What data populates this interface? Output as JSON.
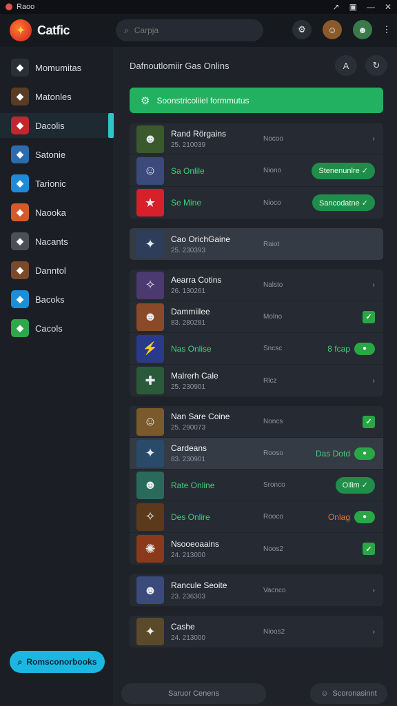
{
  "titlebar": {
    "title": "Raoo",
    "controls": [
      "↗",
      "▣",
      "—",
      "✕"
    ]
  },
  "header": {
    "app_name": "Catfic",
    "search_placeholder": "Carpja",
    "icons": [
      "notifications-icon",
      "trophy-icon",
      "avatar"
    ]
  },
  "sidebar": {
    "items": [
      {
        "label": "Momumitas",
        "icon": "avatar-icon",
        "color": "#2b2f36"
      },
      {
        "label": "Matonles",
        "icon": "game-icon",
        "color": "#5a3b24"
      },
      {
        "label": "Dacolis",
        "icon": "game-icon",
        "color": "#c2262e",
        "active": true
      },
      {
        "label": "Satonie",
        "icon": "game-icon",
        "color": "#2b6cb0"
      },
      {
        "label": "Tarionic",
        "icon": "game-icon",
        "color": "#1f8ad8"
      },
      {
        "label": "Naooka",
        "icon": "game-icon",
        "color": "#d35b2b"
      },
      {
        "label": "Nacants",
        "icon": "game-icon",
        "color": "#4a4f58"
      },
      {
        "label": "Danntol",
        "icon": "game-icon",
        "color": "#7a4a2a"
      },
      {
        "label": "Bacoks",
        "icon": "game-icon",
        "color": "#1c8fd6"
      },
      {
        "label": "Cacols",
        "icon": "game-icon",
        "color": "#2ea84a"
      }
    ],
    "bottom_button": "Romsconorbooks"
  },
  "main": {
    "title": "Dafnoutlomiir Gas Onlins",
    "banner": "Soonstricoliiel formmutus",
    "footer_left": "Saruor Cenens",
    "footer_right": "Scoronasinnt"
  },
  "groups": [
    {
      "rows": [
        {
          "name": "Rand Rörgains",
          "sub": "25. 210039",
          "mid": "Nocoo",
          "right": {
            "type": "chevron"
          },
          "thumb": "#3a5a2e",
          "glyph": "☻"
        },
        {
          "name": "Sa Onlile",
          "green": true,
          "mid": "Niono",
          "right": {
            "type": "pill",
            "text": "Stenenunlre ✓"
          },
          "thumb": "#3b4a7a",
          "glyph": "☺"
        },
        {
          "name": "Se Mine",
          "green": true,
          "mid": "Nioco",
          "right": {
            "type": "pill",
            "text": "Sancodatne ✓"
          },
          "thumb": "#d6202a",
          "glyph": "★"
        }
      ]
    },
    {
      "rows": [
        {
          "name": "Cao OrichGaine",
          "sub": "25. 230393",
          "mid": "Raiot",
          "right": {
            "type": "none"
          },
          "thumb": "#2e3e5a",
          "glyph": "✦",
          "highlight": true
        }
      ]
    },
    {
      "rows": [
        {
          "name": "Aearra Cotins",
          "sub": "26. 130261",
          "mid": "Nalsto",
          "right": {
            "type": "chevron"
          },
          "thumb": "#4a3a70",
          "glyph": "✧"
        },
        {
          "name": "Dammiilee",
          "sub": "83. 280281",
          "mid": "Molno",
          "right": {
            "type": "check"
          },
          "thumb": "#8a4a2a",
          "glyph": "☻"
        },
        {
          "name": "Nas Onlise",
          "green": true,
          "mid": "Sncsc",
          "right": {
            "type": "toggle",
            "text": "8 fcap",
            "color": "#3ed07a"
          },
          "thumb": "#2a3a8a",
          "glyph": "⚡"
        },
        {
          "name": "Malrerh Cale",
          "sub": "25. 230901",
          "mid": "Rlcz",
          "right": {
            "type": "chevron"
          },
          "thumb": "#2a5a3a",
          "glyph": "✚"
        }
      ]
    },
    {
      "rows": [
        {
          "name": "Nan Sare Coine",
          "sub": "25. 290073",
          "mid": "Noncs",
          "right": {
            "type": "check"
          },
          "thumb": "#7a5a2a",
          "glyph": "☺"
        },
        {
          "name": "Cardeans",
          "sub": "83. 230901",
          "mid": "Rooso",
          "right": {
            "type": "toggle",
            "text": "Das Dotd",
            "color": "#3ed07a"
          },
          "thumb": "#2a4a6a",
          "glyph": "✦",
          "highlight": true
        },
        {
          "name": "Rate Online",
          "green": true,
          "mid": "Sronco",
          "right": {
            "type": "pill",
            "text": "Oilim ✓"
          },
          "thumb": "#2a6a5a",
          "glyph": "☻"
        },
        {
          "name": "Des Onlire",
          "green": true,
          "mid": "Rooco",
          "right": {
            "type": "toggle",
            "text": "Onlag",
            "color": "#e8762e"
          },
          "thumb": "#5a3a1a",
          "glyph": "✧"
        },
        {
          "name": "Nsooeoaains",
          "sub": "24. 213000",
          "mid": "Noos2",
          "right": {
            "type": "check"
          },
          "thumb": "#8a3a1a",
          "glyph": "✺"
        }
      ]
    },
    {
      "rows": [
        {
          "name": "Rancule Seoite",
          "sub": "23. 236303",
          "mid": "Vacnco",
          "right": {
            "type": "chevron"
          },
          "thumb": "#3a4a7a",
          "glyph": "☻"
        }
      ]
    },
    {
      "rows": [
        {
          "name": "Cashe",
          "sub": "24. 213000",
          "mid": "Nioos2",
          "right": {
            "type": "chevron"
          },
          "thumb": "#5a4a2a",
          "glyph": "✦"
        }
      ]
    }
  ]
}
